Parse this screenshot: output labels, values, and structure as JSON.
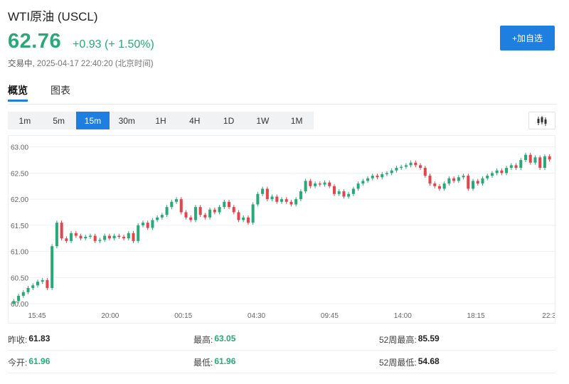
{
  "header": {
    "title": "WTI原油  (USCL)",
    "price": "62.76",
    "change": "+0.93 (+ 1.50%)",
    "status": "交易中,",
    "time": " 2025-04-17 22:40:20 (北京时间)",
    "add_button": "+加自选"
  },
  "tabs": [
    {
      "label": "概览",
      "active": true
    },
    {
      "label": "图表",
      "active": false
    }
  ],
  "timeframes": [
    {
      "label": "1m",
      "active": false
    },
    {
      "label": "5m",
      "active": false
    },
    {
      "label": "15m",
      "active": true
    },
    {
      "label": "30m",
      "active": false
    },
    {
      "label": "1H",
      "active": false
    },
    {
      "label": "4H",
      "active": false
    },
    {
      "label": "1D",
      "active": false
    },
    {
      "label": "1W",
      "active": false
    },
    {
      "label": "1M",
      "active": false
    }
  ],
  "chart_type_icon": "candlestick-icon",
  "colors": {
    "up": "#2aa877",
    "down": "#e0464d",
    "accent": "#1f7fe0"
  },
  "chart_data": {
    "type": "candlestick",
    "ylim": [
      60.0,
      63.05
    ],
    "yticks": [
      "63.00",
      "62.50",
      "62.00",
      "61.50",
      "61.00",
      "60.50",
      "60.00"
    ],
    "ytick_values": [
      63.0,
      62.5,
      62.0,
      61.5,
      61.0,
      60.5,
      60.0
    ],
    "xticks": [
      "15:45",
      "20:00",
      "00:15",
      "04:30",
      "09:45",
      "14:00",
      "18:15",
      "22:3"
    ],
    "closes": [
      60.05,
      60.15,
      60.22,
      60.3,
      60.35,
      60.42,
      60.45,
      60.3,
      61.1,
      61.55,
      61.25,
      61.2,
      61.35,
      61.3,
      61.25,
      61.28,
      61.3,
      61.2,
      61.22,
      61.3,
      61.25,
      61.3,
      61.28,
      61.25,
      61.35,
      61.2,
      61.5,
      61.55,
      61.45,
      61.6,
      61.65,
      61.7,
      61.85,
      61.95,
      62.0,
      61.75,
      61.65,
      61.6,
      61.85,
      61.7,
      61.65,
      61.8,
      61.75,
      61.85,
      61.95,
      61.85,
      61.75,
      61.6,
      61.65,
      61.55,
      61.9,
      62.1,
      62.2,
      62.0,
      62.05,
      61.95,
      62.0,
      61.95,
      61.9,
      62.0,
      62.15,
      62.35,
      62.25,
      62.3,
      62.28,
      62.32,
      62.25,
      62.1,
      62.15,
      62.05,
      62.1,
      62.2,
      62.3,
      62.35,
      62.4,
      62.45,
      62.42,
      62.48,
      62.5,
      62.55,
      62.6,
      62.62,
      62.65,
      62.7,
      62.65,
      62.6,
      62.45,
      62.3,
      62.25,
      62.2,
      62.3,
      62.4,
      62.35,
      62.42,
      62.45,
      62.2,
      62.35,
      62.3,
      62.4,
      62.45,
      62.5,
      62.55,
      62.5,
      62.6,
      62.65,
      62.6,
      62.75,
      62.85,
      62.7,
      62.8,
      62.6,
      62.82,
      62.76
    ],
    "opens": [
      60.0,
      60.05,
      60.15,
      60.22,
      60.3,
      60.35,
      60.42,
      60.45,
      60.3,
      61.1,
      61.55,
      61.25,
      61.2,
      61.35,
      61.3,
      61.25,
      61.28,
      61.3,
      61.2,
      61.22,
      61.3,
      61.25,
      61.3,
      61.28,
      61.25,
      61.35,
      61.2,
      61.5,
      61.55,
      61.45,
      61.6,
      61.65,
      61.7,
      61.85,
      61.95,
      62.0,
      61.75,
      61.65,
      61.6,
      61.85,
      61.7,
      61.65,
      61.8,
      61.75,
      61.85,
      61.95,
      61.85,
      61.75,
      61.6,
      61.65,
      61.55,
      61.9,
      62.1,
      62.2,
      62.0,
      62.05,
      61.95,
      62.0,
      61.95,
      61.9,
      62.0,
      62.15,
      62.35,
      62.25,
      62.3,
      62.28,
      62.32,
      62.25,
      62.1,
      62.15,
      62.05,
      62.1,
      62.2,
      62.3,
      62.35,
      62.4,
      62.45,
      62.42,
      62.48,
      62.5,
      62.55,
      62.6,
      62.62,
      62.65,
      62.7,
      62.65,
      62.6,
      62.45,
      62.3,
      62.25,
      62.2,
      62.3,
      62.4,
      62.35,
      62.42,
      62.45,
      62.2,
      62.35,
      62.3,
      62.4,
      62.45,
      62.5,
      62.55,
      62.5,
      62.6,
      62.65,
      62.6,
      62.75,
      62.85,
      62.7,
      62.8,
      62.6,
      62.82
    ]
  },
  "stats": [
    [
      {
        "label": "昨收:",
        "value": "61.83",
        "color": "normal"
      },
      {
        "label": "最高:",
        "value": "63.05",
        "color": "green"
      },
      {
        "label": "52周最高:",
        "value": "85.59",
        "color": "normal"
      }
    ],
    [
      {
        "label": "今开:",
        "value": "61.96",
        "color": "green"
      },
      {
        "label": "最低:",
        "value": "61.96",
        "color": "green"
      },
      {
        "label": "52周最低:",
        "value": "54.68",
        "color": "normal"
      }
    ]
  ]
}
